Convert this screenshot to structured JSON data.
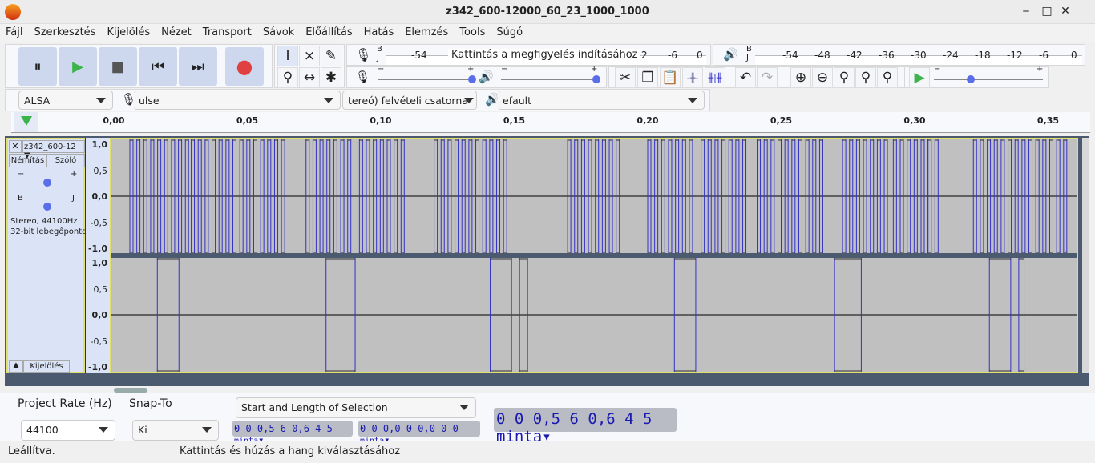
{
  "window": {
    "title": "z342_600-12000_60_23_1000_1000",
    "min": "‒",
    "max": "□",
    "close": "✕"
  },
  "menu": [
    "Fájl",
    "Szerkesztés",
    "Kijelölés",
    "Nézet",
    "Transport",
    "Sávok",
    "Előállítás",
    "Hatás",
    "Elemzés",
    "Tools",
    "Súgó"
  ],
  "transport": {
    "pause": "⏸",
    "play": "▶",
    "stop": "■",
    "skip_start": "⏮",
    "skip_end": "⏭",
    "record": "●"
  },
  "record_meter": {
    "lr": "B\nJ",
    "ticks": [
      "-54",
      "2",
      "-6",
      "0"
    ],
    "hint": "Kattintás a megfigyelés indításához"
  },
  "play_meter": {
    "lr": "B\nJ",
    "ticks": [
      "-54",
      "-48",
      "-42",
      "-36",
      "-30",
      "-24",
      "-18",
      "-12",
      "-6",
      "0"
    ]
  },
  "sliders": {
    "minus": "−",
    "plus": "+",
    "rec_volume": 1.0,
    "play_volume": 1.0,
    "play_speed": 0.33
  },
  "devices": {
    "host": "ALSA",
    "input": "ulse",
    "channels": "tereó) felvételi csatorna",
    "output": "efault"
  },
  "ruler": {
    "ticks": [
      "0,00",
      "0,05",
      "0,10",
      "0,15",
      "0,20",
      "0,25",
      "0,30",
      "0,35"
    ]
  },
  "track": {
    "name": "z342_600-12",
    "mute": "Némítás",
    "solo": "Szóló",
    "gain_minus": "−",
    "gain_plus": "+",
    "pan_left": "B",
    "pan_right": "J",
    "gain": 0.5,
    "pan": 0.5,
    "info1": "Stereo, 44100Hz",
    "info2": "32-bit lebegőpontos",
    "select": "Kijelölés",
    "scale": [
      "1,0",
      "0,5",
      "0,0",
      "-0,5",
      "-1,0"
    ]
  },
  "colors": {
    "waveform": "#3232c8",
    "background": "#c0c0c0",
    "selected_border": "#e2e06a"
  },
  "bottom": {
    "rate_label": "Project Rate (Hz)",
    "rate": "44100",
    "snap_label": "Snap-To",
    "snap": "Ki",
    "selection_mode": "Start and Length of Selection",
    "start": "0 0 0,5 6 0,6 4 5",
    "start_unit": "minta",
    "length": "0 0 0,0 0 0,0 0 0",
    "length_unit": "minta",
    "position": "0 0 0,5 6 0,6 4 5",
    "position_unit": "minta"
  },
  "status": {
    "state": "Leállítva.",
    "hint": "Kattintás és húzás a hang kiválasztásához"
  }
}
